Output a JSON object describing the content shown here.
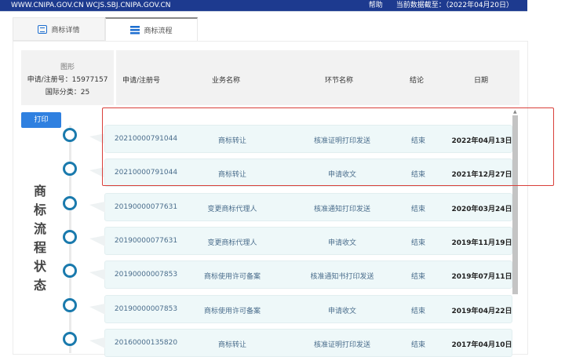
{
  "header": {
    "domains": "WWW.CNIPA.GOV.CN WCJS.SBJ.CNIPA.GOV.CN",
    "help": "帮助",
    "data_as_of": "当前数据截至：（2022年04月20日）"
  },
  "tabs": [
    {
      "label": "商标详情",
      "icon": "document-icon"
    },
    {
      "label": "商标流程",
      "icon": "list-icon"
    }
  ],
  "info": {
    "image_label": "图形",
    "reg_no": "申请/注册号：15977157",
    "class": "国际分类：25"
  },
  "table": {
    "headers": [
      "申请/注册号",
      "业务名称",
      "环节名称",
      "结论",
      "日期"
    ]
  },
  "print_label": "打印",
  "side_title": [
    "商",
    "标",
    "流",
    "程",
    "状",
    "态"
  ],
  "rows": [
    [
      "20210000791044",
      "商标转让",
      "核准证明打印发送",
      "结束",
      "2022年04月13日"
    ],
    [
      "20210000791044",
      "商标转让",
      "申请收文",
      "结束",
      "2021年12月27日"
    ],
    [
      "20190000077631",
      "变更商标代理人",
      "核准通知打印发送",
      "结束",
      "2020年03月24日"
    ],
    [
      "20190000077631",
      "变更商标代理人",
      "申请收文",
      "结束",
      "2019年11月19日"
    ],
    [
      "20190000007853",
      "商标使用许可备案",
      "核准通知书打印发送",
      "结束",
      "2019年07月11日"
    ],
    [
      "20190000007853",
      "商标使用许可备案",
      "申请收文",
      "结束",
      "2019年04月22日"
    ],
    [
      "20160000135820",
      "商标转让",
      "核准证明打印发送",
      "结束",
      "2017年04月10日"
    ]
  ],
  "colors": {
    "header": "#1d3a8f",
    "accent": "#2f80e0",
    "timeline": "#1a7aad",
    "highlight": "#d9403a"
  }
}
